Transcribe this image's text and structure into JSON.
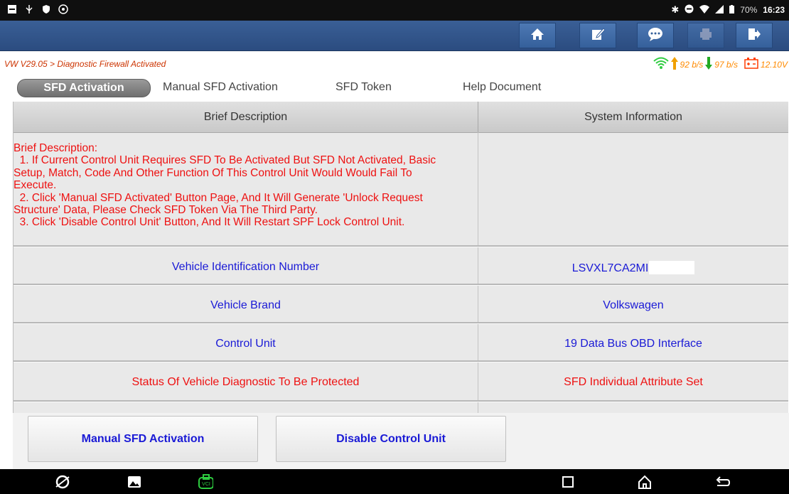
{
  "status_bar": {
    "battery": "70%",
    "time": "16:23",
    "icons_left": [
      "notification-icon",
      "usb-icon",
      "shield-icon",
      "debug-icon"
    ],
    "icons_right": [
      "bluetooth-icon",
      "dnd-icon",
      "wifi-icon",
      "signal-icon",
      "battery-icon"
    ]
  },
  "toolbar": {
    "buttons": [
      {
        "name": "home-button",
        "icon": "home-icon"
      },
      {
        "name": "edit-button",
        "icon": "edit-icon"
      },
      {
        "name": "message-button",
        "icon": "chat-icon"
      },
      {
        "name": "print-button",
        "icon": "print-icon",
        "disabled": true
      },
      {
        "name": "exit-button",
        "icon": "exit-icon"
      }
    ]
  },
  "info": {
    "breadcrumb": "VW V29.05 > Diagnostic Firewall Activated",
    "upload": "92 b/s",
    "download": "97 b/s",
    "voltage": "12.10V"
  },
  "tabs": [
    {
      "label": "SFD Activation",
      "active": true
    },
    {
      "label": "Manual SFD Activation",
      "active": false
    },
    {
      "label": "SFD Token",
      "active": false
    },
    {
      "label": "Help Document",
      "active": false
    }
  ],
  "table": {
    "headers": [
      "Brief Description",
      "System Information"
    ],
    "description_lines": [
      "Brief Description:",
      "  1. If Current Control Unit Requires SFD To Be Activated But SFD Not Activated, Basic",
      "Setup, Match, Code And Other Function Of This Control Unit Would Would Fail To",
      "Execute.",
      "  2. Click 'Manual SFD Activated' Button Page, And It Will Generate 'Unlock Request",
      "Structure' Data, Please Check SFD Token Via The Third Party.",
      "  3. Click 'Disable Control Unit' Button, And It Will Restart SPF Lock Control Unit."
    ],
    "rows": [
      {
        "label": "Vehicle Identification Number",
        "value": "LSVXL7CA2MI",
        "color": "#1a1ad6"
      },
      {
        "label": "Vehicle Brand",
        "value": "Volkswagen",
        "color": "#1a1ad6"
      },
      {
        "label": "Control Unit",
        "value": "19 Data Bus OBD Interface",
        "color": "#1a1ad6"
      },
      {
        "label": "Status Of Vehicle Diagnostic To Be Protected",
        "value": "SFD Individual Attribute Set",
        "color": "#ee1111"
      }
    ]
  },
  "actions": {
    "manual_sfd": "Manual SFD Activation",
    "disable_cu": "Disable Control Unit"
  },
  "nav": {
    "icons": [
      "browser-icon",
      "gallery-icon",
      "vci-icon",
      "recent-apps-icon",
      "home-nav-icon",
      "back-icon"
    ]
  },
  "colors": {
    "toolbar": "#2f5288",
    "accent_red": "#ee1111",
    "accent_blue": "#1a1ad6",
    "speed": "#ff8a00",
    "up_arrow": "#f0a000",
    "down_arrow": "#22aa22"
  }
}
